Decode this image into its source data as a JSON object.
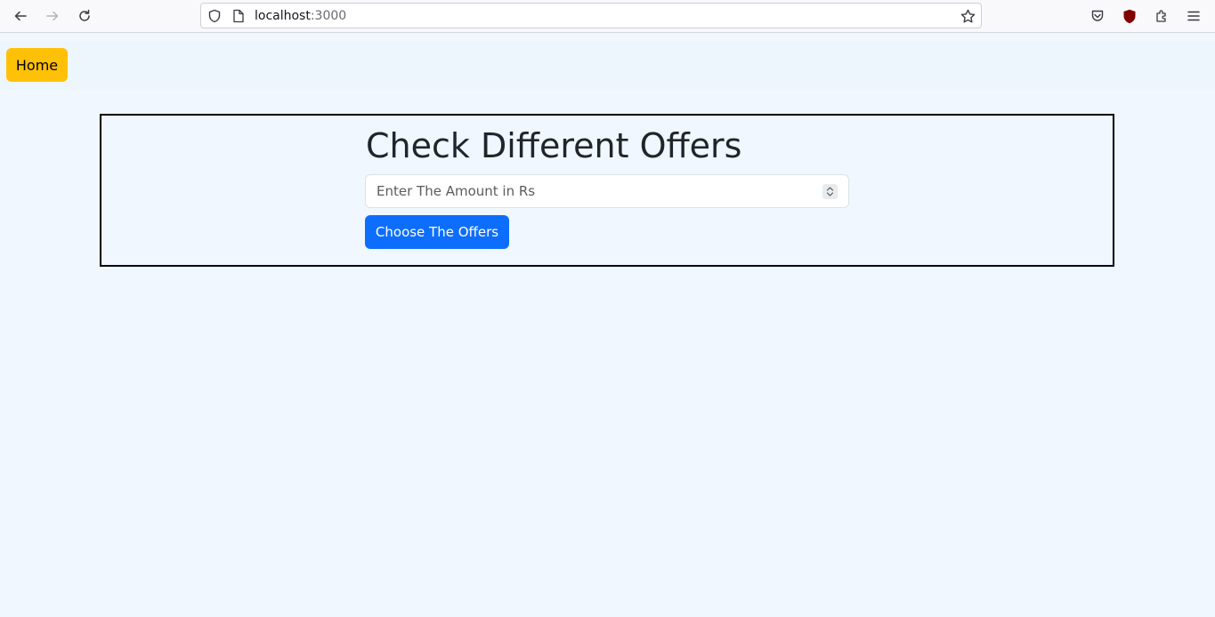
{
  "browser": {
    "url_host": "localhost",
    "url_port": ":3000"
  },
  "navbar": {
    "home_label": "Home"
  },
  "offers": {
    "title": "Check Different Offers",
    "amount_placeholder": "Enter The Amount in Rs",
    "amount_value": "",
    "submit_label": "Choose The Offers"
  },
  "colors": {
    "page_background": "#f0f7fe",
    "home_button": "#ffc107",
    "submit_button": "#0d6efd",
    "box_border": "#000000"
  },
  "icons": {
    "back": "arrow-left-icon",
    "forward": "arrow-right-icon",
    "reload": "reload-icon",
    "site_info": "shield-icon",
    "page": "page-icon",
    "bookmark": "star-icon",
    "pocket": "pocket-icon",
    "ublock": "ublock-icon",
    "extensions": "puzzle-icon",
    "menu": "hamburger-menu-icon",
    "spinner": "number-spinner-icon"
  }
}
